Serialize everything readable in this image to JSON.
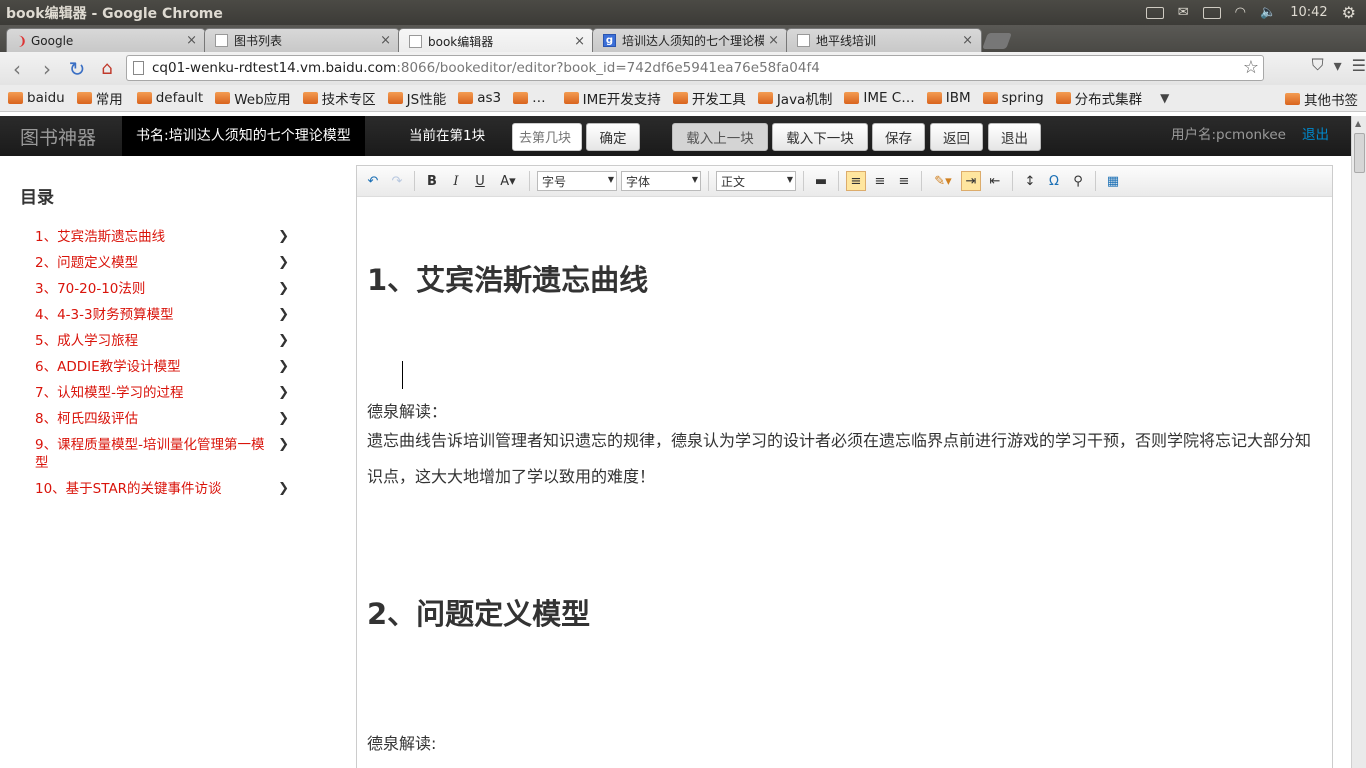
{
  "os": {
    "window_title": "book编辑器 - Google Chrome",
    "time": "10:42"
  },
  "tabs": [
    {
      "label": "Google",
      "active": false
    },
    {
      "label": "图书列表",
      "active": false
    },
    {
      "label": "book编辑器",
      "active": true
    },
    {
      "label": "培训达人须知的七个理论模",
      "active": false
    },
    {
      "label": "地平线培训",
      "active": false
    }
  ],
  "omnibox": {
    "host": "cq01-wenku-rdtest14.vm.baidu.com",
    "rest": ":8066/bookeditor/editor?book_id=742df6e5941ea76e58fa04f4"
  },
  "bookmarks": [
    "baidu",
    "常用",
    "default",
    "Web应用",
    "技术专区",
    "JS性能",
    "as3",
    "…",
    "IME开发支持",
    "开发工具",
    "Java机制",
    "IME C…",
    "IBM",
    "spring",
    "分布式集群"
  ],
  "bookmarks_other": "其他书签",
  "header": {
    "brand": "图书神器",
    "book_name": "书名:培训达人须知的七个理论模型",
    "current_block": "当前在第1块",
    "jump_placeholder": "去第几块",
    "confirm": "确定",
    "load_prev": "载入上一块",
    "load_next": "载入下一块",
    "save": "保存",
    "back": "返回",
    "exit": "退出",
    "username": "用户名:pcmonkee",
    "logout": "退出"
  },
  "toc": {
    "title": "目录",
    "items": [
      "1、艾宾浩斯遗忘曲线",
      "2、问题定义模型",
      "3、70-20-10法则",
      "4、4-3-3财务预算模型",
      "5、成人学习旅程",
      "6、ADDIE教学设计模型",
      "7、认知模型-学习的过程",
      "8、柯氏四级评估",
      "9、课程质量模型-培训量化管理第一模型",
      "10、基于STAR的关键事件访谈"
    ]
  },
  "editor": {
    "font_size_select": "字号",
    "font_family_select": "字体",
    "paragraph_select": "正文",
    "h1": "1、艾宾浩斯遗忘曲线",
    "label1": "德泉解读：",
    "para1": "遗忘曲线告诉培训管理者知识遗忘的规律，德泉认为学习的设计者必须在遗忘临界点前进行游戏的学习干预，否则学院将忘记大部分知识点，这大大地增加了学以致用的难度！",
    "h2": "2、问题定义模型",
    "label2": "德泉解读:"
  }
}
